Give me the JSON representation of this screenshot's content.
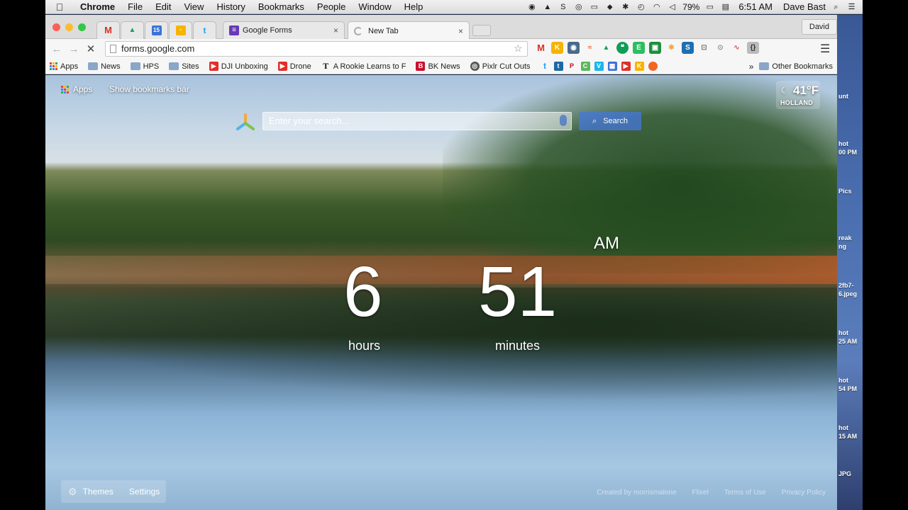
{
  "menubar": {
    "app": "Chrome",
    "items": [
      "File",
      "Edit",
      "View",
      "History",
      "Bookmarks",
      "People",
      "Window",
      "Help"
    ],
    "battery": "79%",
    "time": "6:51 AM",
    "user": "Dave Bast"
  },
  "tabs": {
    "pinned": [
      {
        "icon": "gmail-icon",
        "glyph": "M",
        "color": "#d93025"
      },
      {
        "icon": "drive-icon",
        "glyph": "▲",
        "color": "#1a9e5b"
      },
      {
        "icon": "calendar-icon",
        "glyph": "15",
        "color": "#3b73d7"
      },
      {
        "icon": "keep-icon",
        "glyph": "💡",
        "color": "#f6b400"
      },
      {
        "icon": "twitter-icon",
        "glyph": "t",
        "color": "#1da1f2"
      }
    ],
    "open": [
      {
        "title": "Google Forms",
        "icon": "google-forms-icon",
        "color": "#673ab7",
        "close": "×"
      },
      {
        "title": "New Tab",
        "icon": "loading-icon",
        "color": "#999999",
        "close": "×"
      }
    ],
    "profile": "David"
  },
  "toolbar": {
    "url": "forms.google.com",
    "extensions": [
      {
        "icon": "gmail-icon",
        "glyph": "M",
        "color": "#d93025"
      },
      {
        "icon": "keep-icon",
        "glyph": "K",
        "color": "#f6b400"
      },
      {
        "icon": "screencast-icon",
        "glyph": "◉",
        "color": "#4a6b8a"
      },
      {
        "icon": "rainbow-icon",
        "glyph": "≈",
        "color": "#e56b2a"
      },
      {
        "icon": "drive-icon",
        "glyph": "▲",
        "color": "#1a9e5b"
      },
      {
        "icon": "hangouts-icon",
        "glyph": "❝",
        "color": "#0f9d58"
      },
      {
        "icon": "evernote-icon",
        "glyph": "E",
        "color": "#2dbe60"
      },
      {
        "icon": "classroom-icon",
        "glyph": "▣",
        "color": "#1e8e3e"
      },
      {
        "icon": "pinwheel-icon",
        "glyph": "✱",
        "color": "#f4a742"
      },
      {
        "icon": "s-icon",
        "glyph": "S",
        "color": "#1c6fb3"
      },
      {
        "icon": "cast-icon",
        "glyph": "⊡",
        "color": "#777777"
      },
      {
        "icon": "bulb-icon",
        "glyph": "⊙",
        "color": "#999999"
      },
      {
        "icon": "swoosh-icon",
        "glyph": "∿",
        "color": "#e35d5b"
      },
      {
        "icon": "code-icon",
        "glyph": "{}",
        "color": "#777777"
      }
    ]
  },
  "bookmarks": {
    "items": [
      {
        "label": "Apps",
        "kind": "apps"
      },
      {
        "label": "News",
        "kind": "folder"
      },
      {
        "label": "HPS",
        "kind": "folder"
      },
      {
        "label": "Sites",
        "kind": "folder"
      },
      {
        "label": "DJI Unboxing",
        "kind": "youtube"
      },
      {
        "label": "Drone",
        "kind": "youtube"
      },
      {
        "label": "A Rookie Learns to F",
        "kind": "nyt"
      },
      {
        "label": "BK News",
        "kind": "bk"
      },
      {
        "label": "Pixlr Cut Outs",
        "kind": "pixlr"
      }
    ],
    "icon_only": [
      {
        "icon": "twitter-icon",
        "glyph": "t",
        "color": "#1da1f2"
      },
      {
        "icon": "tweetdeck-icon",
        "glyph": "t",
        "color": "#1b6aa5"
      },
      {
        "icon": "pinterest-icon",
        "glyph": "P",
        "color": "#bd081c"
      },
      {
        "icon": "c-icon",
        "glyph": "C",
        "color": "#5cb85c"
      },
      {
        "icon": "vimeo-icon",
        "glyph": "V",
        "color": "#1ab7ea"
      },
      {
        "icon": "calendar-icon",
        "glyph": "▦",
        "color": "#3b73d7"
      },
      {
        "icon": "youtube-icon",
        "glyph": "▶",
        "color": "#e52d27"
      },
      {
        "icon": "keep-icon",
        "glyph": "K",
        "color": "#f6b400"
      },
      {
        "icon": "orange-icon",
        "glyph": "●",
        "color": "#f26522"
      }
    ],
    "overflow": "»",
    "other": "Other Bookmarks"
  },
  "newtab": {
    "apps_link": "Apps",
    "show_bookmarks": "Show bookmarks bar",
    "weather": {
      "temp": "41°F",
      "city": "HOLLAND"
    },
    "search_placeholder": "Enter your search...",
    "search_button": "Search",
    "clock": {
      "hours": "6",
      "minutes": "51",
      "ampm": "AM",
      "hours_label": "hours",
      "minutes_label": "minutes"
    },
    "themes": "Themes",
    "settings": "Settings",
    "footer": [
      "Created by morrismalone",
      "Flixel",
      "Terms of Use",
      "Privacy Policy"
    ]
  },
  "desktop_side": [
    "unt",
    "hot",
    "00 PM",
    "Pics",
    "reak",
    "ng",
    "2fb7-",
    "6.jpeg",
    "hot",
    "25 AM",
    "hot",
    "54 PM",
    "hot",
    "15 AM",
    "JPG"
  ]
}
